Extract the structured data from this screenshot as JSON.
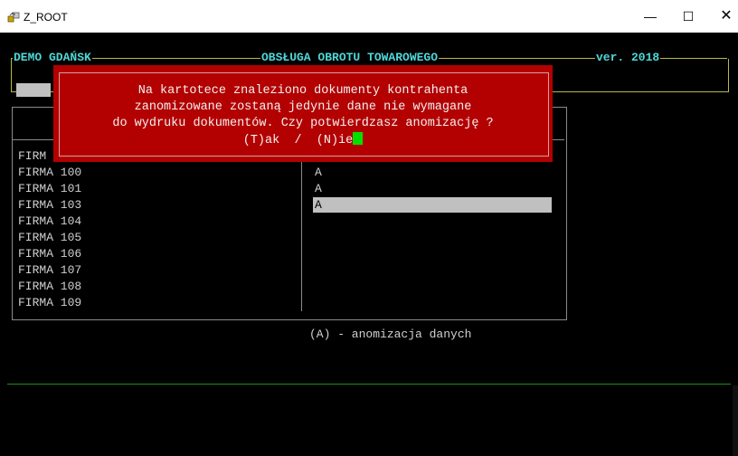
{
  "window": {
    "title": "Z_ROOT",
    "minimize_icon": "minimize-icon",
    "maximize_icon": "maximize-icon",
    "close_icon": "close-icon"
  },
  "header": {
    "company": "DEMO GDAŃSK",
    "module": "OBSŁUGA OBROTU TOWAROWEGO",
    "version": "ver. 2018"
  },
  "dialog": {
    "line1": "Na kartotece znaleziono dokumenty kontrahenta",
    "line2": "zanomizowane zostaną jedynie dane nie wymagane",
    "line3": "do wydruku dokumentów. Czy potwierdzasz anomizację ?",
    "yes": "(T)ak",
    "slash": "/",
    "no": "(N)ie"
  },
  "list": {
    "rows": [
      {
        "name": "FIRM",
        "mark": ""
      },
      {
        "name": "FIRMA 100",
        "mark": "A"
      },
      {
        "name": "FIRMA 101",
        "mark": "A"
      },
      {
        "name": "FIRMA 103",
        "mark": "A"
      },
      {
        "name": "FIRMA 104",
        "mark": ""
      },
      {
        "name": "FIRMA 105",
        "mark": ""
      },
      {
        "name": "FIRMA 106",
        "mark": ""
      },
      {
        "name": "FIRMA 107",
        "mark": ""
      },
      {
        "name": "FIRMA 108",
        "mark": ""
      },
      {
        "name": "FIRMA 109",
        "mark": ""
      }
    ]
  },
  "footer": {
    "legend": "(A) - anomizacja danych"
  },
  "colors": {
    "header_text": "#4fd7d7",
    "frame": "#b8b84a",
    "dialog_bg": "#b30000",
    "cursor": "#00e000",
    "selection": "#c0c0c0",
    "green_line": "#1b8f1b"
  }
}
